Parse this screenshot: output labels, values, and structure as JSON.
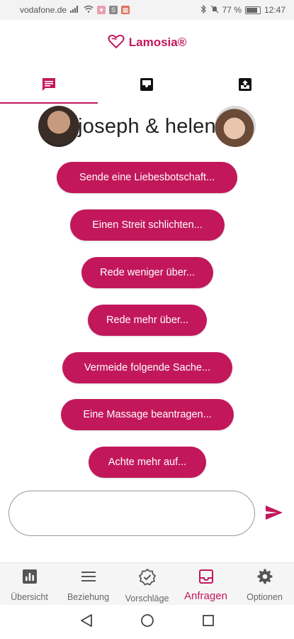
{
  "status_bar": {
    "carrier": "vodafone.de",
    "battery": "77 %",
    "time": "12:47"
  },
  "header": {
    "logo_text": "Lamosia®"
  },
  "tabs": [
    {
      "name": "chat-icon",
      "active": true
    },
    {
      "name": "inbox-icon",
      "active": false
    },
    {
      "name": "inbox-arrow-icon",
      "active": false
    }
  ],
  "couple": {
    "names": "joseph & helen"
  },
  "suggestions": [
    {
      "label": "Sende eine Liebesbotschaft..."
    },
    {
      "label": "Einen Streit schlichten..."
    },
    {
      "label": "Rede weniger über..."
    },
    {
      "label": "Rede mehr über..."
    },
    {
      "label": "Vermeide folgende Sache..."
    },
    {
      "label": "Eine Massage beantragen..."
    },
    {
      "label": "Achte mehr auf..."
    }
  ],
  "input": {
    "placeholder": "",
    "value": ""
  },
  "bottom_nav": [
    {
      "label": "Übersicht",
      "icon": "bar-chart-icon",
      "active": false
    },
    {
      "label": "Beziehung",
      "icon": "menu-icon",
      "active": false
    },
    {
      "label": "Vorschläge",
      "icon": "verified-badge-icon",
      "active": false
    },
    {
      "label": "Anfragen",
      "icon": "inbox-icon",
      "active": true
    },
    {
      "label": "Optionen",
      "icon": "gear-icon",
      "active": false
    }
  ],
  "colors": {
    "accent": "#c2185b",
    "nav_inactive": "#666666"
  }
}
